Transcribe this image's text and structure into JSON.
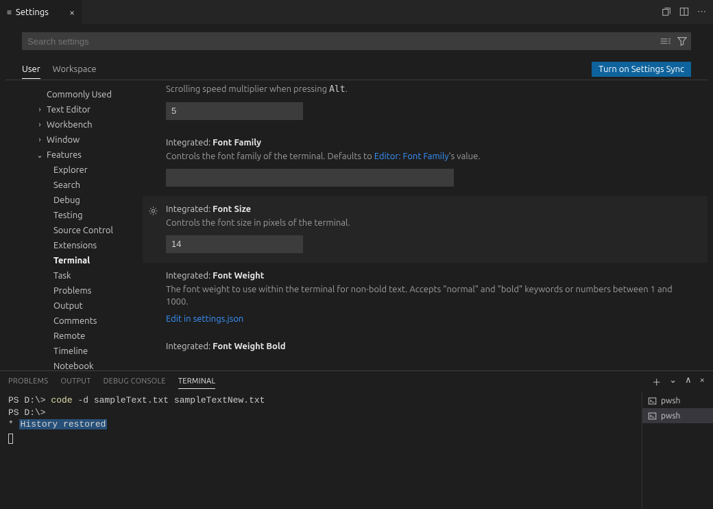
{
  "tab": {
    "title": "Settings"
  },
  "search": {
    "placeholder": "Search settings"
  },
  "scope": {
    "user": "User",
    "workspace": "Workspace",
    "sync": "Turn on Settings Sync"
  },
  "toc": {
    "commonly_used": "Commonly Used",
    "text_editor": "Text Editor",
    "workbench": "Workbench",
    "window": "Window",
    "features": "Features",
    "children": {
      "explorer": "Explorer",
      "search": "Search",
      "debug": "Debug",
      "testing": "Testing",
      "source_control": "Source Control",
      "extensions": "Extensions",
      "terminal": "Terminal",
      "task": "Task",
      "problems": "Problems",
      "output": "Output",
      "comments": "Comments",
      "remote": "Remote",
      "timeline": "Timeline",
      "notebook": "Notebook"
    }
  },
  "settings": {
    "alt_scroll": {
      "desc_pre": "Scrolling speed multiplier when pressing ",
      "desc_kbd": "Alt",
      "desc_post": ".",
      "value": "5"
    },
    "font_family": {
      "scope": "Integrated:",
      "name": "Font Family",
      "desc_pre": "Controls the font family of the terminal. Defaults to ",
      "desc_link": "Editor: Font Family",
      "desc_post": "'s value.",
      "value": ""
    },
    "font_size": {
      "scope": "Integrated:",
      "name": "Font Size",
      "desc": "Controls the font size in pixels of the terminal.",
      "value": "14"
    },
    "font_weight": {
      "scope": "Integrated:",
      "name": "Font Weight",
      "desc": "The font weight to use within the terminal for non-bold text. Accepts \"normal\" and \"bold\" keywords or numbers between 1 and 1000.",
      "edit": "Edit in settings.json"
    },
    "font_weight_bold": {
      "scope": "Integrated:",
      "name": "Font Weight Bold"
    }
  },
  "panel": {
    "tabs": {
      "problems": "PROBLEMS",
      "output": "OUTPUT",
      "debug": "DEBUG CONSOLE",
      "terminal": "TERMINAL"
    },
    "terminal": {
      "line1_prompt": "PS D:\\> ",
      "line1_cmd": "code",
      "line1_args": " -d sampleText.txt sampleTextNew.txt",
      "line2_prompt": "PS D:\\>",
      "hist_star": " * ",
      "hist_text": " History restored "
    },
    "side": {
      "pwsh1": "pwsh",
      "pwsh2": "pwsh"
    }
  }
}
